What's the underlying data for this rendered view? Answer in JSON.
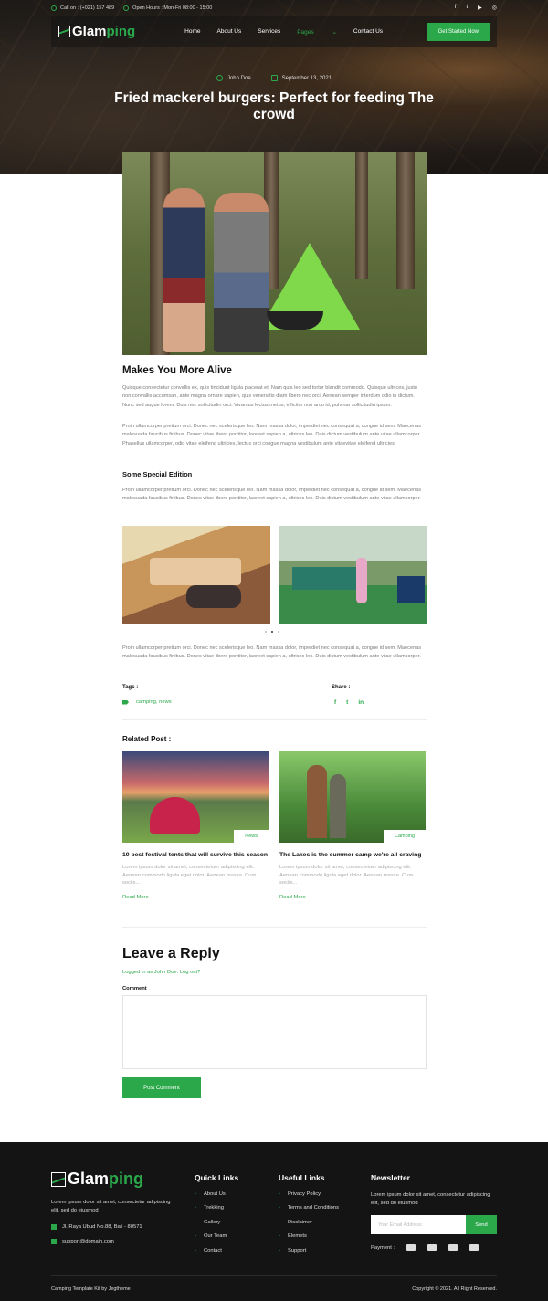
{
  "topbar": {
    "phone": "Call on : (+021) 157 489",
    "hours": "Open Hours : Mon-Fri 08:00 - 15:00",
    "social": [
      "f",
      "t",
      "▶",
      "◎"
    ]
  },
  "brand": {
    "name_white": "Glam",
    "name_green": "ping"
  },
  "nav": {
    "items": [
      "Home",
      "About Us",
      "Services",
      "Pages",
      "Contact Us"
    ],
    "active": "Pages",
    "cta": "Get Started Now"
  },
  "post": {
    "author": "John Doe",
    "date": "September 13, 2021",
    "title": "Fried mackerel burgers: Perfect for feeding The crowd",
    "section_heading": "Makes You More Alive",
    "para1": "Quisque consectetur convallis ex, quis tincidunt ligula placerat et. Nam quis leo sed tortor blandit commodo. Quisque ultrices, justo non convallis accumsan, ante magna ornare sapien, quis venenatis diam libero nec orci. Aenean semper interdum odio in dictum. Nunc sed augue lorem. Duis nec sollicitudin orci. Vivamus lectus metus, efficitur non arcu id, pulvinar sollicitudin ipsum.",
    "para2": "Proin ullamcorper pretium orci. Donec nec scelerisque leo. Nam massa dolor, imperdiet nec consequat a, congue id sem. Maecenas malesuada faucibus finibus. Donec vitae libero porttitor, laoreet sapien a, ultrices leo. Duis dictum vestibulum ante vitae ullamcorper. Phasellus ullamcorper, odio vitae eleifend ultricies, lectus orci congue magna vestibulum ante vitaevitae eleifend ultricies.",
    "sub_heading": "Some Special Edition",
    "para3": "Proin ullamcorper pretium orci. Donec nec scelerisque leo. Nam massa dolor, imperdiet nec consequat a, congue id sem. Maecenas malesuada faucibus finibus. Donec vitae libero porttitor, laoreet sapien a, ultrices leo. Duis dictum vestibulum ante vitae ullamcorper.",
    "para4": "Proin ullamcorper pretium orci. Donec nec scelerisque leo. Nam massa dolor, imperdiet nec consequat a, congue id sem. Maecenas malesuada faucibus finibus. Donec vitae libero porttitor, laoreet sapien a, ultrices leo. Duis dictum vestibulum ante vitae ullamcorper.",
    "tags_label": "Tags :",
    "tags": "camping, news",
    "share_label": "Share :",
    "share_icons": [
      "f",
      "t",
      "in"
    ]
  },
  "related": {
    "heading": "Related Post :",
    "posts": [
      {
        "badge": "News",
        "title": "10 best festival tents that will survive this season",
        "excerpt": "Lorem ipsum dolor sit amet, consectetuer adipiscing elit. Aenean commodo ligula eget dolor. Aenean massa. Cum sociis...",
        "more": "Read More"
      },
      {
        "badge": "Camping",
        "title": "The Lakes is the summer camp we're all craving",
        "excerpt": "Lorem ipsum dolor sit amet, consectetuer adipiscing elit. Aenean commodo ligula eget dolor. Aenean massa. Cum sociis...",
        "more": "Read More"
      }
    ]
  },
  "reply": {
    "heading": "Leave a Reply",
    "logged": "Logged in as John Doe. Log out?",
    "comment_label": "Comment",
    "button": "Post Comment"
  },
  "footer": {
    "desc": "Lorem ipsum dolor sit amet, consectetur adipiscing elit, sed do eiusmod",
    "address": "Jl. Raya Ubud No.88, Bali - 80571",
    "email": "support@domain.com",
    "quick_title": "Quick Links",
    "quick": [
      "About Us",
      "Trekking",
      "Gallery",
      "Our Team",
      "Contact"
    ],
    "useful_title": "Useful Links",
    "useful": [
      "Privacy Policy",
      "Terms and Conditions",
      "Disclaimer",
      "Elemets",
      "Support"
    ],
    "news_title": "Newsletter",
    "news_desc": "Lorem ipsum dolor sit amet, consectetur adipiscing elit, sed do eiusmod",
    "email_placeholder": "Your Email Address",
    "send": "Send",
    "payment_label": "Payment :",
    "credit": "Camping Template Kit by Jegtheme",
    "copyright": "Copyright © 2021. All Right Reserved."
  }
}
